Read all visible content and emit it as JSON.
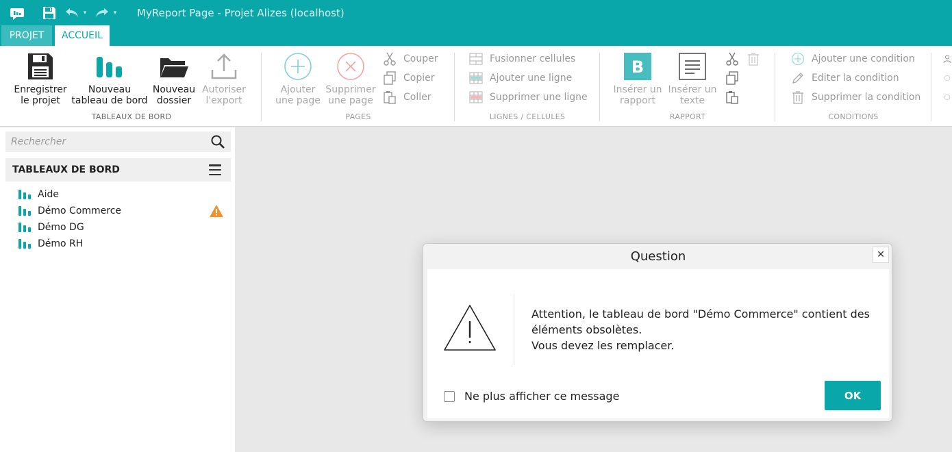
{
  "window": {
    "title": "MyReport Page - Projet Alizes (localhost)"
  },
  "tabs": [
    {
      "label": "PROJET",
      "active": false
    },
    {
      "label": "ACCUEIL",
      "active": true
    }
  ],
  "ribbon": {
    "tableaux_de_bord": {
      "label": "TABLEAUX DE BORD",
      "enregistrer": "Enregistrer\nle projet",
      "nouveau_tableau": "Nouveau\ntableau de bord",
      "nouveau_dossier": "Nouveau\ndossier",
      "autoriser_export": "Autoriser\nl'export"
    },
    "pages": {
      "label": "PAGES",
      "ajouter_page": "Ajouter\nune page",
      "supprimer_page": "Supprimer\nune page",
      "couper": "Couper",
      "copier": "Copier",
      "coller": "Coller"
    },
    "lignes": {
      "label": "LIGNES / CELLULES",
      "fusionner": "Fusionner cellules",
      "ajouter_ligne": "Ajouter une ligne",
      "supprimer_ligne": "Supprimer une ligne"
    },
    "rapport": {
      "label": "RAPPORT",
      "inserer_rapport": "Insérer un\nrapport",
      "inserer_texte": "Insérer un\ntexte"
    },
    "conditions": {
      "label": "CONDITIONS",
      "ajouter_condition": "Ajouter une condition",
      "editer_condition": "Editer la condition",
      "supprimer_condition": "Supprimer la condition"
    }
  },
  "sidebar": {
    "search_placeholder": "Rechercher",
    "header": "TABLEAUX DE BORD",
    "items": [
      {
        "label": "Aide",
        "warning": false
      },
      {
        "label": "Démo Commerce",
        "warning": true
      },
      {
        "label": "Démo DG",
        "warning": false
      },
      {
        "label": "Démo RH",
        "warning": false
      }
    ]
  },
  "dialog": {
    "title": "Question",
    "close": "✕",
    "message_line1": "Attention, le tableau de bord \"Démo Commerce\" contient des éléments obsolètes.",
    "message_line2": "Vous devez les remplacer.",
    "checkbox_label": "Ne plus afficher ce message",
    "checkbox_checked": false,
    "ok_label": "OK"
  },
  "colors": {
    "accent": "#0aa7aa",
    "warning": "#f0932b"
  }
}
